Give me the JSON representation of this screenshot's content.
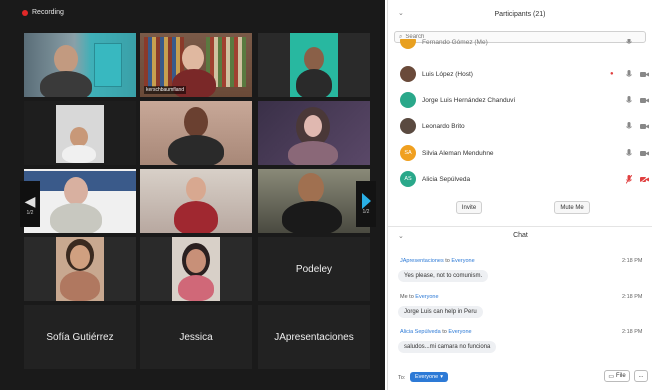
{
  "gallery": {
    "recording_label": "Recording",
    "page_left": "1/2",
    "page_right": "1/2",
    "tiles": [
      {
        "name": ""
      },
      {
        "name": "kerschbaumfland"
      },
      {
        "name": ""
      },
      {
        "name": ""
      },
      {
        "name": ""
      },
      {
        "name": ""
      },
      {
        "name": ""
      },
      {
        "name": ""
      },
      {
        "name": ""
      },
      {
        "name": ""
      },
      {
        "name": ""
      },
      {
        "name": "Podeley"
      },
      {
        "name": "Sofía Gutiérrez"
      },
      {
        "name": "Jessica"
      },
      {
        "name": "JApresentaciones"
      }
    ]
  },
  "participants": {
    "title": "Participants (21)",
    "search_placeholder": "Search",
    "items": [
      {
        "name": "Fernando Gómez (Me)",
        "initials": "",
        "avatar_color": "#e8a020"
      },
      {
        "name": "Luis López (Host)",
        "initials": "",
        "avatar_color": "#6a4a3a"
      },
      {
        "name": "Jorge Luis Hernández Chanduví",
        "initials": "",
        "avatar_color": "#2aa88a"
      },
      {
        "name": "Leonardo Brito",
        "initials": "",
        "avatar_color": "#5a4a40"
      },
      {
        "name": "Silvia Aleman Menduhne",
        "initials": "SA",
        "avatar_color": "#f0a020"
      },
      {
        "name": "Alicia Sepúlveda",
        "initials": "AS",
        "avatar_color": "#2aa88a"
      }
    ],
    "invite_label": "Invite",
    "mute_me_label": "Mute Me"
  },
  "chat": {
    "title": "Chat",
    "messages": [
      {
        "from": "JApresentaciones",
        "to_word": "to",
        "to": "Everyone",
        "time": "2:18 PM",
        "text": "Yes please, not to comunism."
      },
      {
        "from": "Me",
        "to_word": "to",
        "to": "Everyone",
        "time": "2:18 PM",
        "text": "Jorge Luis can help in Peru"
      },
      {
        "from": "Alicia Sepúlveda",
        "to_word": "to",
        "to": "Everyone",
        "time": "2:18 PM",
        "text": "saludos...mi camara no funciona"
      }
    ],
    "to_label": "To:",
    "to_value": "Everyone",
    "file_label": "File",
    "more_label": "..."
  },
  "colors": {
    "accent_blue": "#2d7ad6",
    "recording_red": "#e02828",
    "speaker_outline": "#d8d050"
  }
}
